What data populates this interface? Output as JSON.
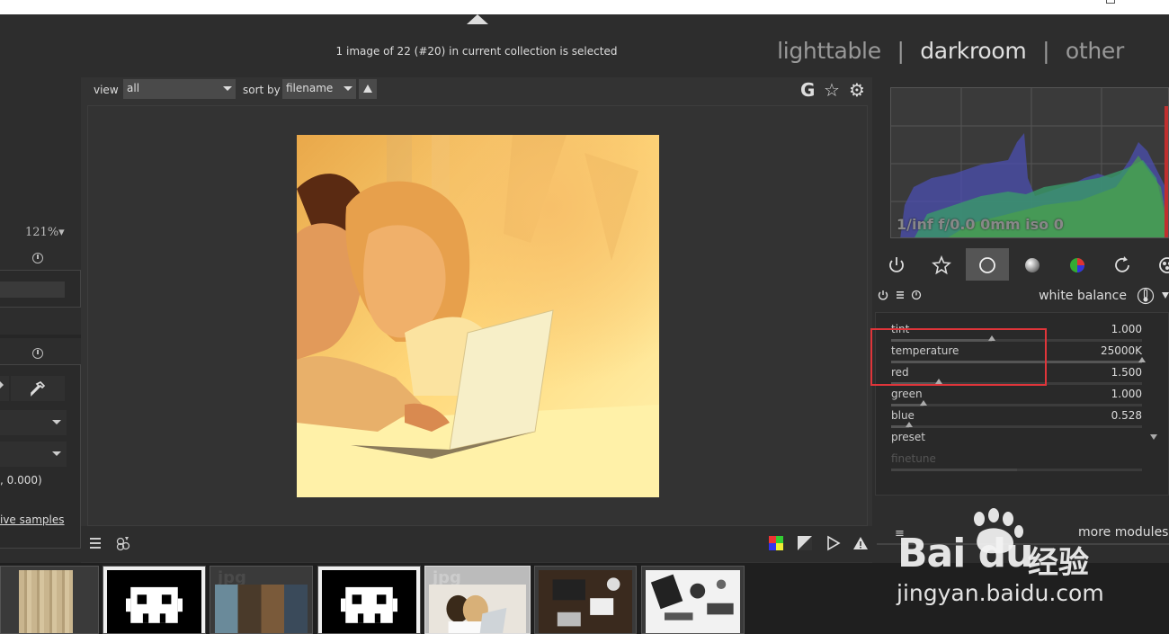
{
  "top": {
    "selection_info": "1 image of 22 (#20) in current collection is selected"
  },
  "views": {
    "lighttable": "lighttable",
    "darkroom": "darkroom",
    "other": "other",
    "separator": "|"
  },
  "toolbar": {
    "view_label": "view",
    "view_value": "all",
    "sort_label": "sort by",
    "sort_value": "filename",
    "icons": [
      "grouping-icon",
      "star-icon",
      "gear-icon"
    ],
    "grouping_glyph": "G",
    "star_glyph": "☆",
    "gear_glyph": "⚙"
  },
  "left_panel": {
    "zoom": "121%▾",
    "coords": ", 0.000)",
    "samples_link": "ive samples"
  },
  "histogram": {
    "info": "1/inf f/0.0 0mm iso 0"
  },
  "module_tabs": [
    "power-icon",
    "favorites-icon",
    "base-icon",
    "tone-icon",
    "color-icon",
    "correct-icon",
    "effects-icon"
  ],
  "white_balance": {
    "title": "white balance",
    "sliders": [
      {
        "label": "tint",
        "value": "1.000",
        "position": 0.4
      },
      {
        "label": "temperature",
        "value": "25000K",
        "position": 1.0
      },
      {
        "label": "red",
        "value": "1.500",
        "position": 0.19
      },
      {
        "label": "green",
        "value": "1.000",
        "position": 0.13
      },
      {
        "label": "blue",
        "value": "0.528",
        "position": 0.07
      }
    ],
    "preset_label": "preset",
    "finetune_label": "finetune"
  },
  "more_modules": "more modules",
  "filmstrip": {
    "ext_label": "jpg",
    "thumbs": [
      "wood",
      "pixel-skull",
      "bookshelf",
      "pixel-skull",
      "couple-laptop",
      "desk-top",
      "desk-items"
    ]
  },
  "watermark": {
    "brand": "Bai du",
    "cn": "经验",
    "url": "jingyan.baidu.com"
  },
  "colors": {
    "highlight": "#e0353a",
    "photo_tint": "#ffe07a"
  }
}
